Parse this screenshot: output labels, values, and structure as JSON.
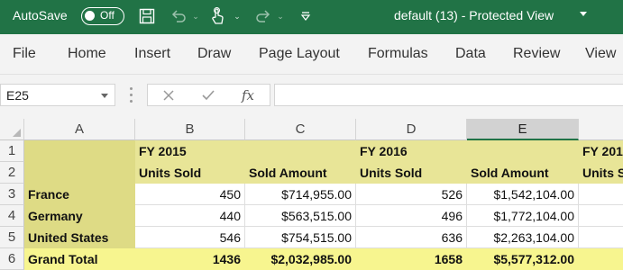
{
  "colors": {
    "titlebar": "#217346",
    "ribbon": "#f3f3f3",
    "highlight": "#e8e597",
    "row_labels_fill": "#dedb85",
    "grand_total_fill": "#f7f58f"
  },
  "titlebar": {
    "autosave_label": "AutoSave",
    "autosave_state": "Off",
    "icons": [
      "save-icon",
      "undo-icon",
      "touch-mode-icon",
      "redo-icon",
      "customize-quick-access-icon"
    ],
    "document_title": "default (13)  -  Protected View"
  },
  "ribbon": {
    "tabs": [
      "File",
      "Home",
      "Insert",
      "Draw",
      "Page Layout",
      "Formulas",
      "Data",
      "Review",
      "View"
    ]
  },
  "formula_bar": {
    "name_box": "E25",
    "cancel_icon": "cancel-icon",
    "enter_icon": "checkmark-icon",
    "function_label": "fx",
    "formula_value": ""
  },
  "sheet": {
    "columns": [
      "A",
      "B",
      "C",
      "D",
      "E"
    ],
    "active_column": "E",
    "rows": [
      "1",
      "2",
      "3",
      "4",
      "5",
      "6"
    ],
    "header_row1": {
      "B": "FY 2015",
      "D": "FY 2016",
      "F": "FY 201"
    },
    "header_row2": {
      "B": "Units Sold",
      "C": "Sold Amount",
      "D": "Units Sold",
      "E": "Sold Amount",
      "F": "Units S"
    },
    "data_rows": [
      {
        "label": "France",
        "b": "450",
        "c": "$714,955.00",
        "d": "526",
        "e": "$1,542,104.00"
      },
      {
        "label": "Germany",
        "b": "440",
        "c": "$563,515.00",
        "d": "496",
        "e": "$1,772,104.00"
      },
      {
        "label": "United States",
        "b": "546",
        "c": "$754,515.00",
        "d": "636",
        "e": "$2,263,104.00"
      }
    ],
    "total_row": {
      "label": "Grand Total",
      "b": "1436",
      "c": "$2,032,985.00",
      "d": "1658",
      "e": "$5,577,312.00"
    }
  }
}
